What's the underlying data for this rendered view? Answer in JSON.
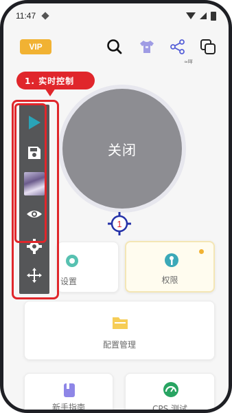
{
  "status_bar": {
    "time": "11:47"
  },
  "top_bar": {
    "vip_label": "VIP",
    "bubble_text": "≈咩"
  },
  "power_button": {
    "label": "关闭"
  },
  "count_marker": {
    "value": "1"
  },
  "annotation": {
    "callout_text": "1. 实时控制"
  },
  "tiles": {
    "settings": {
      "label": "设置"
    },
    "permissions": {
      "label": "权限"
    },
    "config": {
      "label": "配置管理"
    },
    "guide": {
      "label": "新手指南"
    },
    "cps_test": {
      "label": "CPS 测试"
    }
  },
  "colors": {
    "accent_red": "#e0262b",
    "vip_gold": "#f1b233",
    "marker_blue": "#2431a8",
    "play_teal": "#2aa3b7"
  },
  "icons": {
    "search": "search-icon",
    "theme": "tshirt-icon",
    "share": "share-icon",
    "window": "multi-window-icon",
    "play": "play-icon",
    "save": "save-icon",
    "eye": "eye-icon",
    "gear": "gear-icon",
    "move": "move-icon"
  }
}
